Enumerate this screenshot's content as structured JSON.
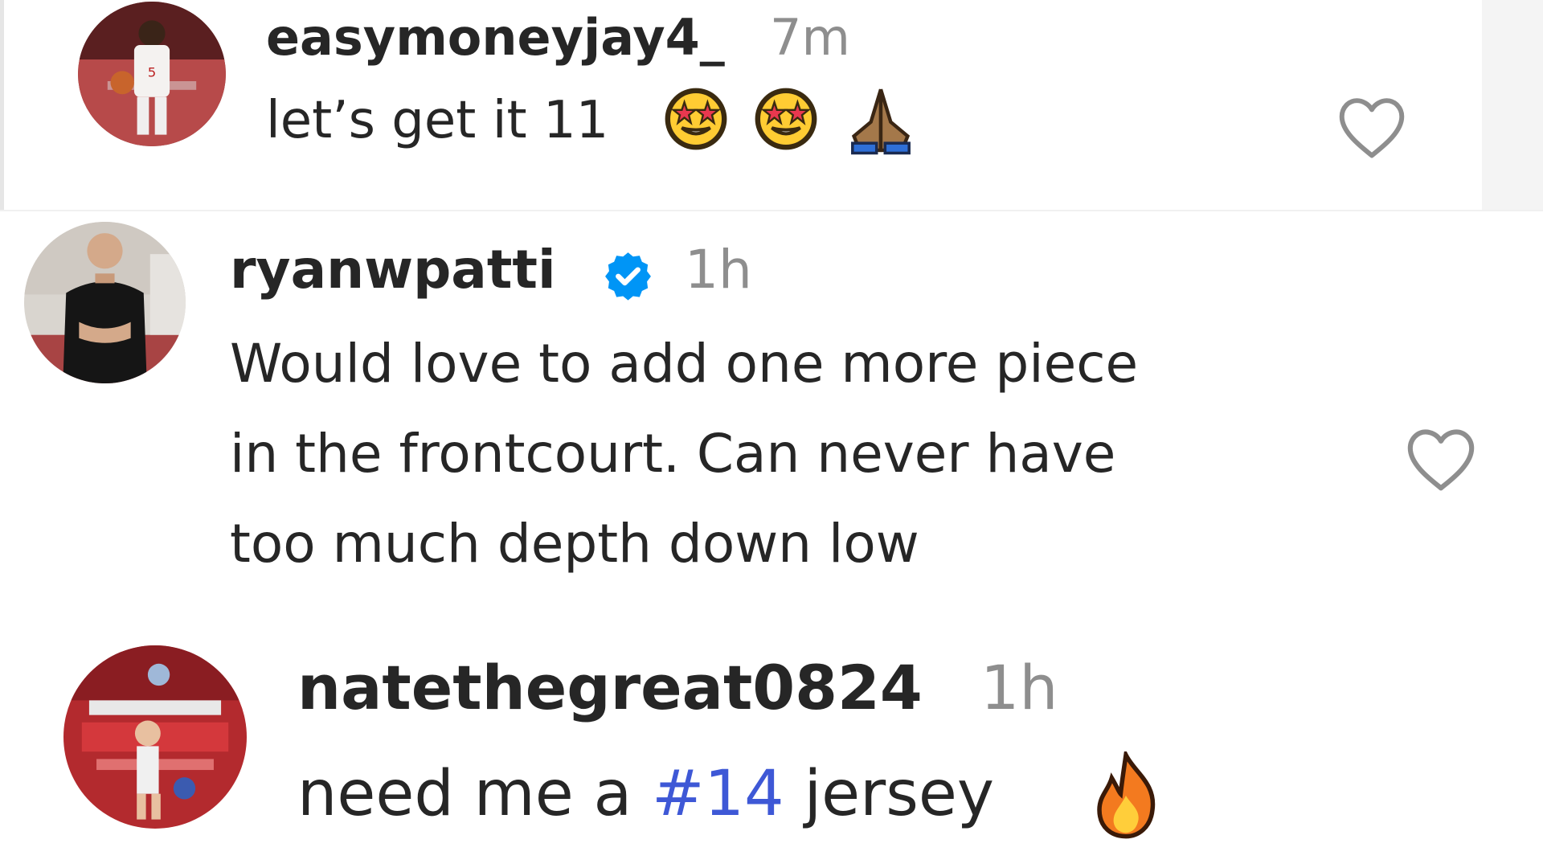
{
  "comments": [
    {
      "username": "easymoneyjay4_",
      "time": "7m",
      "text": "let’s get it 11",
      "emojis": [
        "star-struck-emoji",
        "star-struck-emoji",
        "folded-hands-emoji"
      ],
      "verified": false
    },
    {
      "username": "ryanwpatti",
      "time": "1h",
      "text_lines": [
        "Would love to add one more piece",
        "in the frontcourt. Can never have",
        "too much depth down low"
      ],
      "verified": true
    },
    {
      "username": "natethegreat0824",
      "time": "1h",
      "text_before": "need me a ",
      "hashtag": "#14",
      "text_after": " jersey",
      "emojis": [
        "fire-emoji"
      ],
      "verified": false
    }
  ],
  "icons": {
    "like": "heart-outline-icon",
    "verified": "verified-badge-icon"
  },
  "colors": {
    "text": "#262626",
    "secondary": "#8e8e8e",
    "hashtag": "#3e58d6",
    "verified": "#0095f6"
  }
}
